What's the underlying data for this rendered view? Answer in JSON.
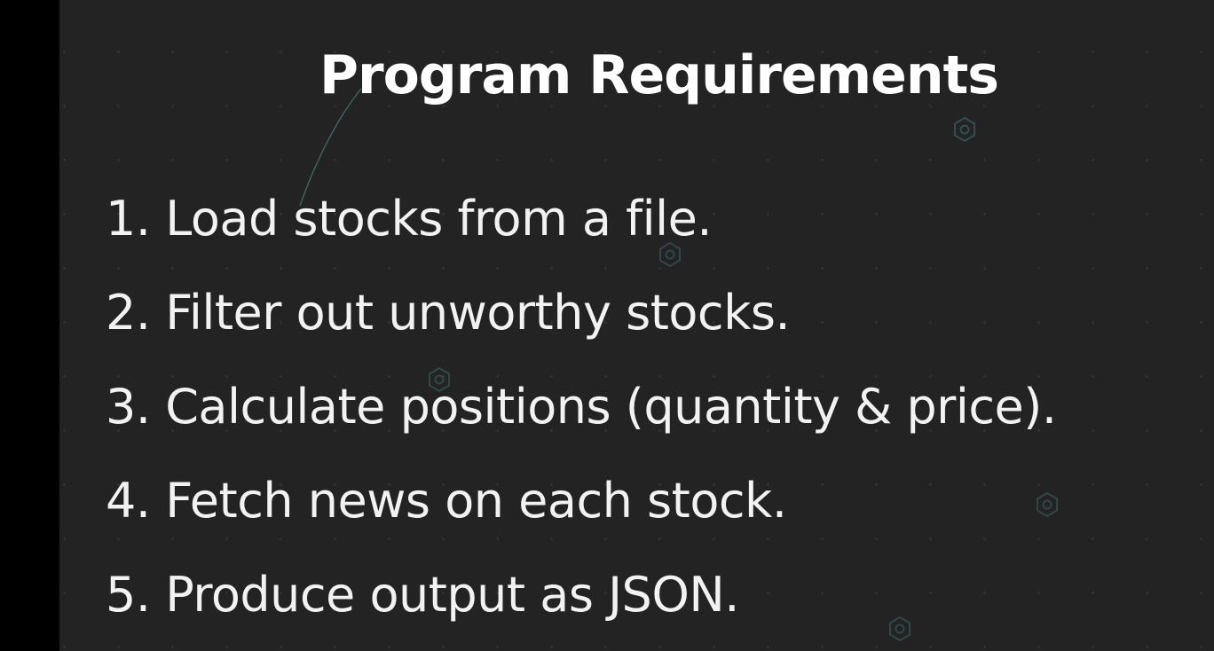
{
  "slide": {
    "title": "Program Requirements",
    "items": [
      {
        "number": "1.",
        "text": "Load stocks from a file."
      },
      {
        "number": "2.",
        "text": "Filter out unworthy stocks."
      },
      {
        "number": "3.",
        "text": "Calculate positions (quantity & price)."
      },
      {
        "number": "4.",
        "text": "Fetch news on each stock."
      },
      {
        "number": "5.",
        "text": "Produce output as JSON."
      }
    ]
  },
  "colors": {
    "background": "#232323",
    "border": "#000000",
    "text": "#ffffff",
    "accent": "#4e7f86"
  },
  "decorations": [
    "hexagon-icon",
    "hexagon-icon",
    "hexagon-icon",
    "hexagon-icon",
    "hexagon-icon"
  ]
}
